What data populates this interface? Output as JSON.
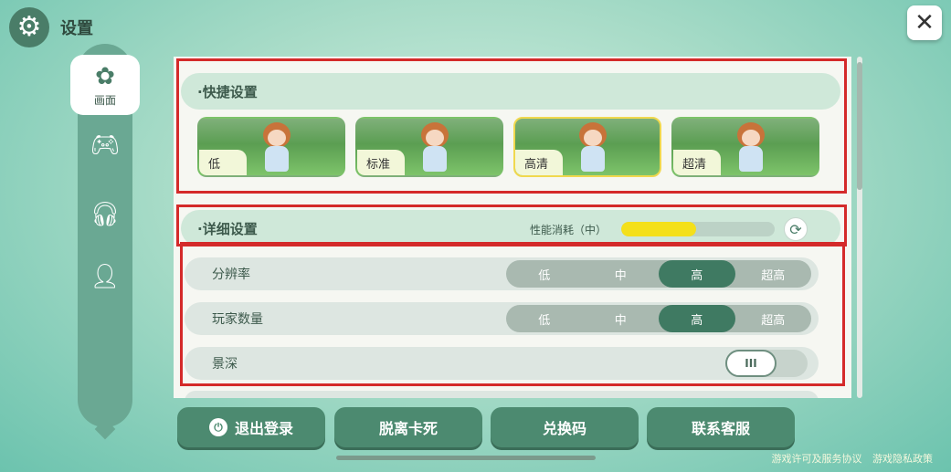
{
  "header": {
    "title": "设置",
    "settings_icon": "gear-icon",
    "close_icon": "close-icon",
    "close_glyph": "✕"
  },
  "sidenav": {
    "items": [
      {
        "icon": "display-icon",
        "glyph": "✿",
        "label": "画面",
        "active": true
      },
      {
        "icon": "gamepad-icon",
        "glyph": "🎮︎",
        "label": "",
        "active": false
      },
      {
        "icon": "headphones-icon",
        "glyph": "🎧︎",
        "label": "",
        "active": false
      },
      {
        "icon": "user-chat-icon",
        "glyph": "👤︎",
        "label": "",
        "active": false
      }
    ]
  },
  "quick": {
    "title": "·快捷设置",
    "presets": [
      {
        "label": "低",
        "selected": false
      },
      {
        "label": "标准",
        "selected": false
      },
      {
        "label": "高清",
        "selected": true
      },
      {
        "label": "超清",
        "selected": false
      }
    ]
  },
  "detail": {
    "title": "·详细设置",
    "perf_label": "性能消耗（中）",
    "perf_level": 0.49,
    "refresh_icon": "refresh-icon",
    "refresh_glyph": "⟳",
    "rows": [
      {
        "label": "分辨率",
        "options": [
          "低",
          "中",
          "高",
          "超高"
        ],
        "selected": 2
      },
      {
        "label": "玩家数量",
        "options": [
          "低",
          "中",
          "高",
          "超高"
        ],
        "selected": 2
      },
      {
        "label": "景深",
        "toggle_text": "III",
        "toggle_on": false
      }
    ]
  },
  "buttons": {
    "logout": "退出登录",
    "logout_icon": "power-icon",
    "unstuck": "脱离卡死",
    "redeem": "兑换码",
    "support": "联系客服"
  },
  "legal": {
    "terms": "游戏许可及服务协议",
    "privacy": "游戏隐私政策"
  },
  "colors": {
    "accent": "#4c8a70",
    "highlight": "#d42a2a",
    "perf_fill": "#f4e01a"
  }
}
